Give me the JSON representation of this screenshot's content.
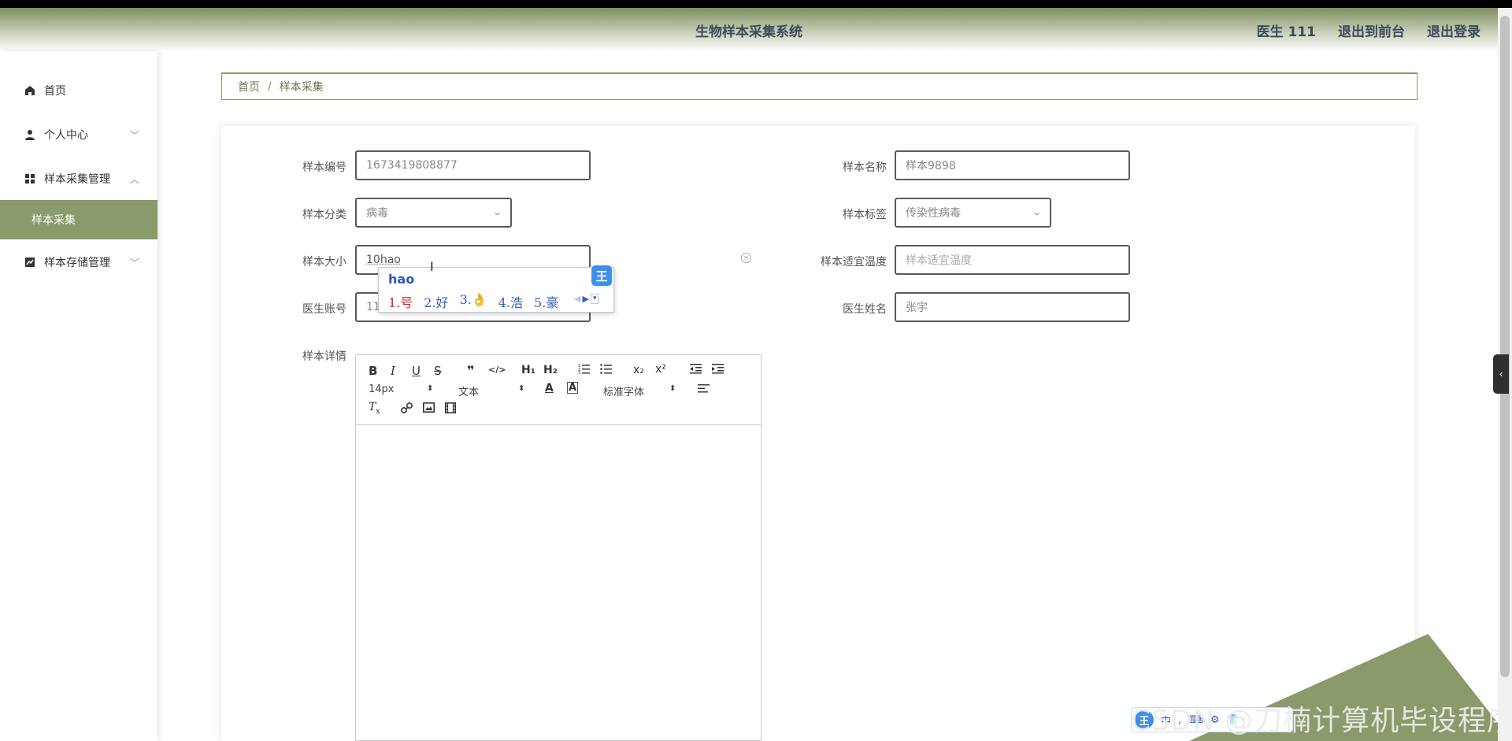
{
  "header": {
    "title": "生物样本采集系统",
    "user": "医生 111",
    "exit_front": "退出到前台",
    "logout": "退出登录"
  },
  "sidebar": {
    "items": [
      {
        "label": "首页",
        "icon": "home-icon"
      },
      {
        "label": "个人中心",
        "icon": "user-icon",
        "chevron": "﹀"
      },
      {
        "label": "样本采集管理",
        "icon": "grid-icon",
        "chevron": "︿"
      },
      {
        "label": "样本存储管理",
        "icon": "chart-icon",
        "chevron": "﹀"
      }
    ],
    "active_sub": "样本采集"
  },
  "breadcrumb": {
    "home": "首页",
    "sep": "/",
    "current": "样本采集"
  },
  "form": {
    "sample_no": {
      "label": "样本编号",
      "value": "1673419808877"
    },
    "sample_name": {
      "label": "样本名称",
      "value": "样本9898"
    },
    "sample_category": {
      "label": "样本分类",
      "value": "病毒"
    },
    "sample_tag": {
      "label": "样本标签",
      "value": "传染性病毒"
    },
    "sample_size": {
      "label": "样本大小",
      "value": "10hao"
    },
    "sample_temp": {
      "label": "样本适宜温度",
      "placeholder": "样本适宜温度"
    },
    "doctor_account": {
      "label": "医生账号",
      "value": "11"
    },
    "doctor_name": {
      "label": "医生姓名",
      "value": "张宇"
    },
    "detail": {
      "label": "样本详情"
    }
  },
  "ime": {
    "pinyin": "hao",
    "candidates": [
      "1.号",
      "2.好",
      "3.👌",
      "4.浩",
      "5.豪"
    ],
    "logo": "王"
  },
  "editor": {
    "font_size": "14px",
    "paragraph": "文本",
    "font_family": "标准字体",
    "bold": "B",
    "italic": "I",
    "underline": "U",
    "strike": "S",
    "quote": "❞",
    "code": "</>",
    "h1": "H₁",
    "h2": "H₂",
    "sub": "x₂",
    "sup": "x²"
  },
  "watermark": "CSDN @刀楠计算机毕设程序",
  "ime_bar": {
    "logo": "王",
    "mode": "中"
  }
}
